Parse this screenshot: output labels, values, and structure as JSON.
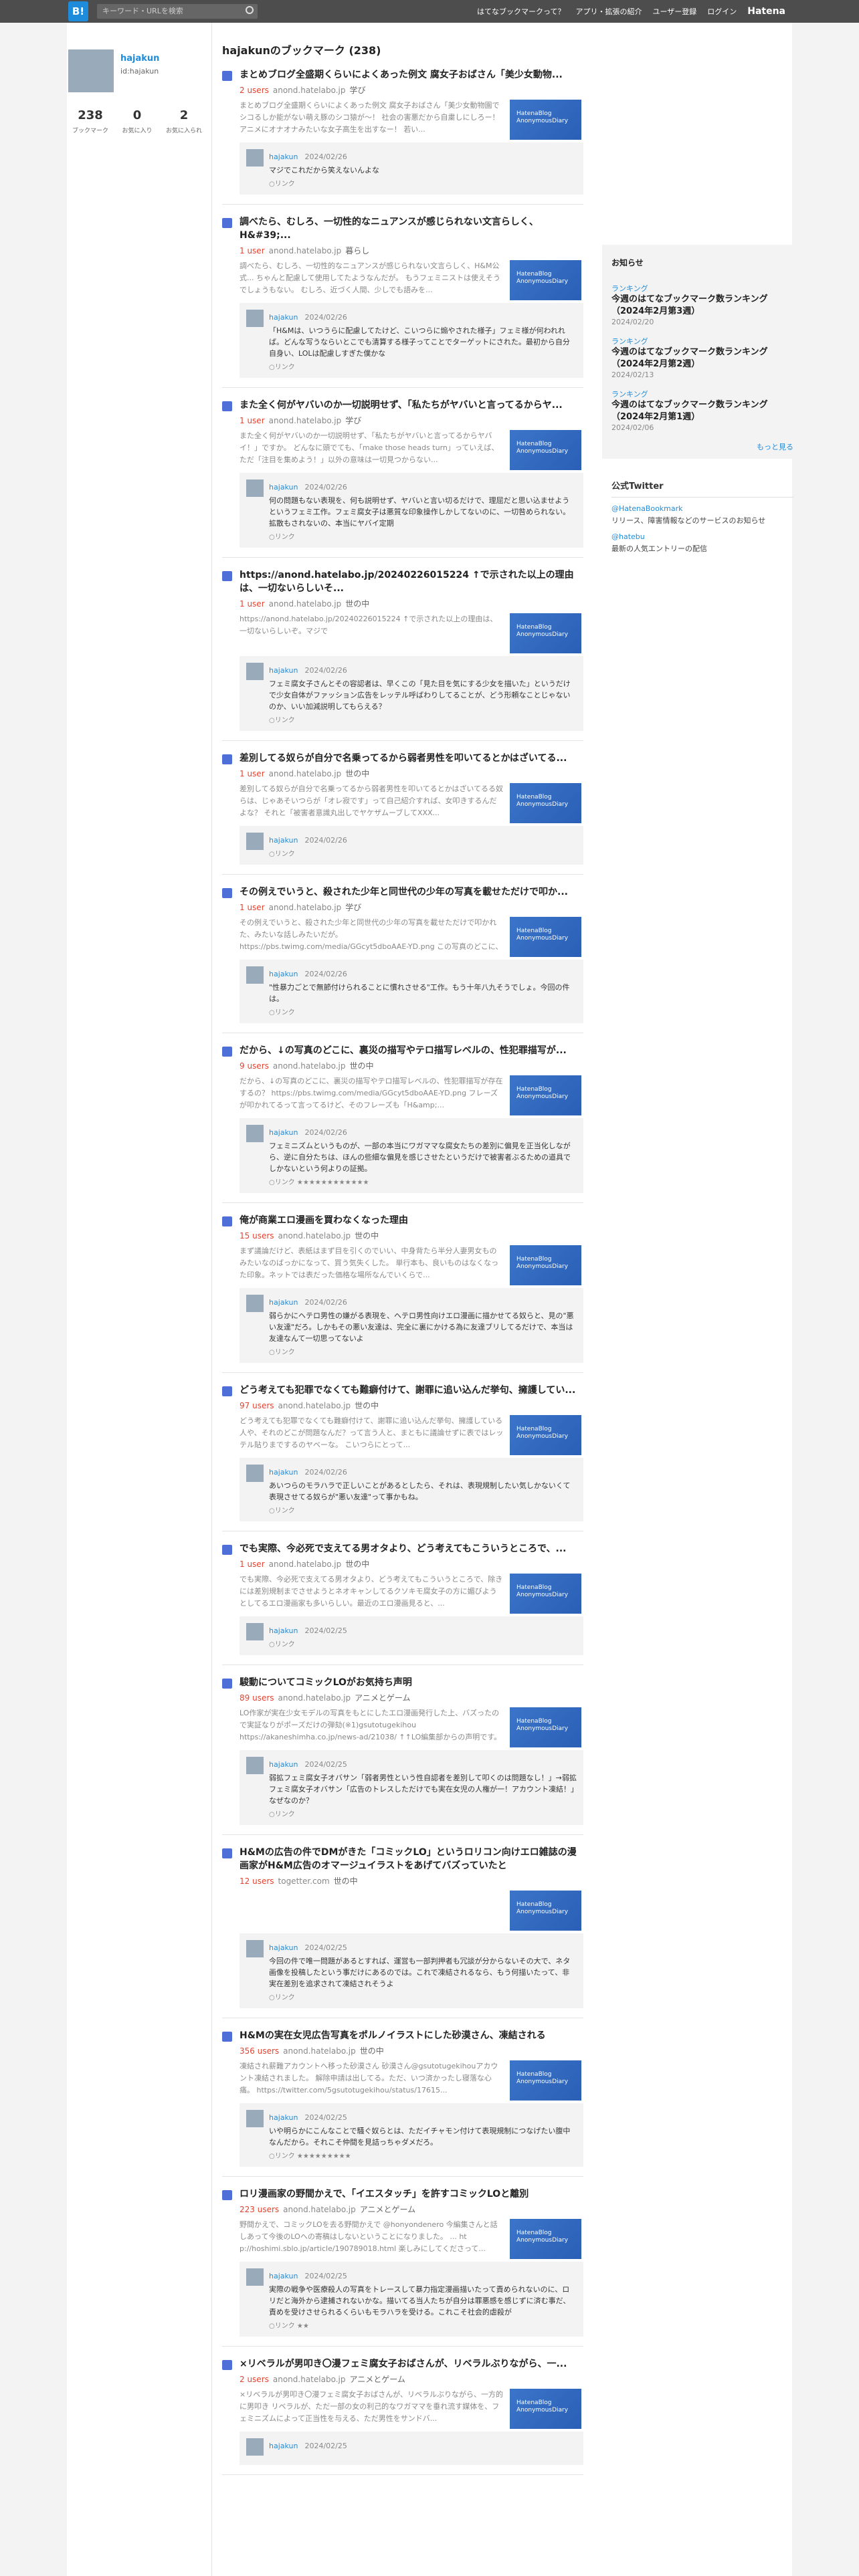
{
  "topbar": {
    "logo": "B!",
    "search_placeholder": "キーワード・URLを検索",
    "nav": [
      "はてなブックマークって？",
      "アプリ・拡張の紹介",
      "ユーザー登録",
      "ログイン",
      "Hatena"
    ]
  },
  "profile": {
    "name": "hajakun",
    "id": "id:hajakun",
    "stats": [
      {
        "num": "238",
        "label": "ブックマーク"
      },
      {
        "num": "0",
        "label": "お気に入り"
      },
      {
        "num": "2",
        "label": "お気に入られ"
      }
    ]
  },
  "heading": "hajakunのブックマーク (238)",
  "entries": [
    {
      "title": "まとめブログ全盛期くらいによくあった例文 腐女子おばさん「美少女動物...",
      "users": "2 users",
      "domain": "anond.hatelabo.jp",
      "cat": "学び",
      "summary": "まとめブログ全盛期くらいによくあった例文 腐女子おばさん「美少女動物園でシコるしか能がない萌え豚のシコ猿が〜！ 社会の害悪だから自粛しにしろー！ アニメにオナオナみたいな女子高生を出すなー！ 若い...",
      "cu": "hajakun",
      "cdate": "2024/02/26",
      "ctext": "マジでこれだから笑えないんよな",
      "cstar": "○リンク"
    },
    {
      "title": "調べたら、むしろ、一切性的なニュアンスが感じられない文言らしく、H&#39;...",
      "users": "1 user",
      "domain": "anond.hatelabo.jp",
      "cat": "暮らし",
      "summary": "調べたら、むしろ、一切性的なニュアンスが感じられない文言らしく、H&M公式... ちゃんと配慮して使用してたようなんだが。 もうフェミニストは使えそうでしょうもない。 むしろ、近づく人間、少しでも語みを...",
      "cu": "hajakun",
      "cdate": "2024/02/26",
      "ctext": "「H&Mは、いつうらに配慮してたけど、こいつらに煽やされた様子」フェミ様が何われれば。どんな写うならいとこでも清算する様子ってことでターゲットにされた。最初から自分自身い、LOLは配慮しすぎた僕かな",
      "cstar": "○リンク"
    },
    {
      "title": "また全く何がヤバいのか一切説明せず、「私たちがヤバいと言ってるからヤ...",
      "users": "1 user",
      "domain": "anond.hatelabo.jp",
      "cat": "学び",
      "summary": "また全く何がヤバいのか一切説明せず、「私たちがヤバいと言ってるからヤバイ！」ですか。 どんなに頭でても、「make those heads turn」っていえば、ただ「注目を集めよう！」以外の意味は一切見つからない...",
      "cu": "hajakun",
      "cdate": "2024/02/26",
      "ctext": "何の問題もない表現を、何も説明せず、ヤバいと言い切るだけで、理屈だと思い込ませようというフェミ工作。フェミ腐女子は悪質な印象操作しかしてないのに、一切咎められない。拡散もされないの、本当にヤバイ定期",
      "cstar": "○リンク"
    },
    {
      "title": "https://anond.hatelabo.jp/20240226015224 ↑で示された以上の理由は、一切ないらしいそ...",
      "users": "1 user",
      "domain": "anond.hatelabo.jp",
      "cat": "世の中",
      "summary": "https://anond.hatelabo.jp/20240226015224 ↑で示された以上の理由は、一切ないらしいぞ。マジで",
      "cu": "hajakun",
      "cdate": "2024/02/26",
      "ctext": "フェミ腐女子さんとその容認者は、早くこの「見た目を気にする少女を描いた」というだけで少女自体がファッション広告をレッテル呼ばわりしてることが、どう形頼なことじゃないのか、いい加減説明してもらえる？",
      "cstar": "○リンク"
    },
    {
      "title": "差別してる奴らが自分で名乗ってるから弱者男性を叩いてるとかはざいてる...",
      "users": "1 user",
      "domain": "anond.hatelabo.jp",
      "cat": "世の中",
      "summary": "差別してる奴らが自分で名乗ってるから弱者男性を叩いてるとかはざいてるる奴らは、じゃあそいつらが「オレ寂です」って自己紹介すれば、女叩きするんだよな？ それと「被害者意識丸出しでヤケザムーブしてXXX...",
      "cu": "hajakun",
      "cdate": "2024/02/26",
      "ctext": "",
      "cstar": "○リンク"
    },
    {
      "title": "その例えでいうと、殺された少年と同世代の少年の写真を載せただけで叩か...",
      "users": "1 user",
      "domain": "anond.hatelabo.jp",
      "cat": "学び",
      "summary": "その例えでいうと、殺された少年と同世代の少年の写真を載せただけで叩かれた、みたいな話しみたいだが。 https://pbs.twimg.com/media/GGcyt5dboAAE-YD.png この写真のどこに、体育とか性被害を想起させる...",
      "cu": "hajakun",
      "cdate": "2024/02/26",
      "ctext": "\"性暴力ごとで無節付けられることに慣れさせる\"工作。もう十年八九そうでしょ。今回の件は。",
      "cstar": "○リンク"
    },
    {
      "title": "だから、↓の写真のどこに、裏災の描写やテロ描写レベルの、性犯罪描写が...",
      "users": "9 users",
      "domain": "anond.hatelabo.jp",
      "cat": "世の中",
      "summary": "だから、↓の写真のどこに、裏災の描写やテロ描写レベルの、性犯罪描写が存在するの？ https://pbs.twimg.com/media/GGcyt5dboAAE-YD.png フレーズが叩かれてるって言ってるけど、そのフレーズも「H&amp;...",
      "cu": "hajakun",
      "cdate": "2024/02/26",
      "ctext": "フェミニズムというものが、一部の本当にワガママな腐女たちの差別に偏見を正当化しながら、逆に自分たちは、ほんの些細な偏見を感じさせたというだけで被害者ぶるための道具でしかないという何よりの証拠。",
      "cstar": "○リンク ★★★★★★★★★★★★"
    },
    {
      "title": "俺が商業エロ漫画を買わなくなった理由",
      "users": "15 users",
      "domain": "anond.hatelabo.jp",
      "cat": "世の中",
      "summary": "まず議論だけど、表紙はまず目を引くのでいい、中身背たら半分人妻男女ものみたいなのばっかになって、買う気失くした。 単行本も、良いものはなくなった印象。ネットでは表だった価格な場所なんでいくらで...",
      "cu": "hajakun",
      "cdate": "2024/02/26",
      "ctext": "弱らかにヘテロ男性の嫌がる表現を、ヘテロ男性向けエロ漫画に描かせてる奴らと、見の\"悪い友達\"だろ。しかもその悪い友達は、完全に裏にかける為に友達ブリしてるだけで、本当は友達なんて一切思ってないよ",
      "cstar": "○リンク"
    },
    {
      "title": "どう考えても犯罪でなくても難癖付けて、謝罪に追い込んだ挙句、擁護してい...",
      "users": "97 users",
      "domain": "anond.hatelabo.jp",
      "cat": "世の中",
      "summary": "どう考えても犯罪でなくても難癖付けて、謝罪に追い込んだ挙句、擁護している人や、それのどこが問題なんだ？って言う人と、まともに議論せずに表ではレッテル貼りまでするのヤベーな。 こいつらにとって...",
      "cu": "hajakun",
      "cdate": "2024/02/26",
      "ctext": "あいつらのモラハラで正しいことがあるとしたら、それは、表現規制したい気しかないくて表現させてる奴らが\"悪い友達\"って事かもね。",
      "cstar": "○リンク"
    },
    {
      "title": "でも実際、今必死で支えてる男オタより、どう考えてもこういうところで、...",
      "users": "1 user",
      "domain": "anond.hatelabo.jp",
      "cat": "世の中",
      "summary": "でも実際、今必死で支えてる男オタより、どう考えてもこういうところで、除きには差別規制までさせようとネオキャンしてるクソキモ腐女子の方に媚びようとしてるエロ漫画家も多いらしい。最近のエロ漫画見ると、...",
      "cu": "hajakun",
      "cdate": "2024/02/25",
      "ctext": "",
      "cstar": "○リンク"
    },
    {
      "title": "駿動についてコミックLOがお気持ち声明",
      "users": "89 users",
      "domain": "anond.hatelabo.jp",
      "cat": "アニメとゲーム",
      "summary": "LO作家が実在少女モデルの写真をもとにしたエロ漫画発行した上、バズったので実証なりがポーズだけの弾劾(※1)gsutotugekihou https://akaneshimha.co.jp/news-ad/21038/ ↑↑LO編集部からの声明です。免...",
      "cu": "hajakun",
      "cdate": "2024/02/25",
      "ctext": "弱拡フェミ腐女子オバサン「弱者男性という性自認者を差別して叩くのは問題なし！」→弱拡フェミ腐女子オバサン「広告のトレスしただけでも実在女児の人権が一！アカウント凍結！」なぜなのか？",
      "cstar": "○リンク"
    },
    {
      "title": "H&Mの広告の件でDMがきた「コミックLO」というロリコン向けエロ雑誌の漫画家がH&M広告のオマージュイラストをあげてバズっていたと",
      "users": "12 users",
      "domain": "togetter.com",
      "cat": "世の中",
      "summary": "",
      "cu": "hajakun",
      "cdate": "2024/02/25",
      "ctext": "今回の件で唯一問題があるとすれば、運営も一部判押者も冗談が分からないその大で、ネタ画像を投稿したという事だけにあるのでは。これで凍結されるなら、もう何描いたって、非実在差別を追求されて凍結されそうよ",
      "cstar": "○リンク"
    },
    {
      "title": "H&Mの実在女児広告写真をポルノイラストにした砂漠さん、凍結される",
      "users": "356 users",
      "domain": "anond.hatelabo.jp",
      "cat": "世の中",
      "summary": "凍結され薪難アカウントへ移った砂漠さん 砂漠さん@gsutotugekihouアカウント凍結されました。 解除申請は出してる。ただ、いつ済かったし寝落な心痛。 https://twitter.com/5gsutotugekihou/status/17615...",
      "cu": "hajakun",
      "cdate": "2024/02/25",
      "ctext": "いや明らかにこんなことで騒ぐ奴らとは、ただイチャモン付けて表現規制につなげたい腹中なんだから。それこそ仲間を見詰っちゃダメだろ。",
      "cstar": "○リンク ★★★★★★★★★"
    },
    {
      "title": "ロリ漫画家の野間かえで、「イエスタッチ」を許すコミックLOと離別",
      "users": "223 users",
      "domain": "anond.hatelabo.jp",
      "cat": "アニメとゲーム",
      "summary": "野間かえで、コミックLOを去る野間かえで @honyondenero 今編集さんと話しあって今後のLOへの寄稿はしないということになりました。 ... ht p://hoshimi.sblo.jp/article/190789018.html 楽しみにしてくださって...",
      "cu": "hajakun",
      "cdate": "2024/02/25",
      "ctext": "実際の戦争や医療殺人の写真をトレースして暴力指定漫画描いたって責められないのに、ロリだと海外から逮捕されないかな。描いてる当人たちが自分は罪悪感を感じずに済む事だ、責めを受けさせられるくらいもモラハラを受ける。これこそ社会的虐殺が",
      "cstar": "○リンク ★★"
    },
    {
      "title": "×リベラルが男叩き〇漫フェミ腐女子おばさんが、リベラルぶりながら、一...",
      "users": "2 users",
      "domain": "anond.hatelabo.jp",
      "cat": "アニメとゲーム",
      "summary": "×リベラルが男叩き〇漫フェミ腐女子おばさんが、リベラルぶりながら、一方的に男叩き リベラルが、ただ一部の女の利己的なワガママを垂れ流す媒体を、フェミニズムによって正当性を与える、ただ男性をサンドバ...",
      "cu": "hajakun",
      "cdate": "2024/02/25",
      "ctext": "",
      "cstar": ""
    }
  ],
  "notice": {
    "title": "お知らせ",
    "items": [
      {
        "label": "ランキング",
        "text": "今週のはてなブックマーク数ランキング（2024年2月第3週）",
        "date": "2024/02/20"
      },
      {
        "label": "ランキング",
        "text": "今週のはてなブックマーク数ランキング（2024年2月第2週）",
        "date": "2024/02/13"
      },
      {
        "label": "ランキング",
        "text": "今週のはてなブックマーク数ランキング（2024年2月第1週）",
        "date": "2024/02/06"
      }
    ],
    "more": "もっと見る"
  },
  "twitter": {
    "title": "公式Twitter",
    "links": [
      {
        "handle": "@HatenaBookmark",
        "desc": "リリース、障害情報などのサービスのお知らせ"
      },
      {
        "handle": "@hatebu",
        "desc": "最新の人気エントリーの配信"
      }
    ]
  },
  "thumb_text": "HatenaBlog\nAnonymousDiary"
}
